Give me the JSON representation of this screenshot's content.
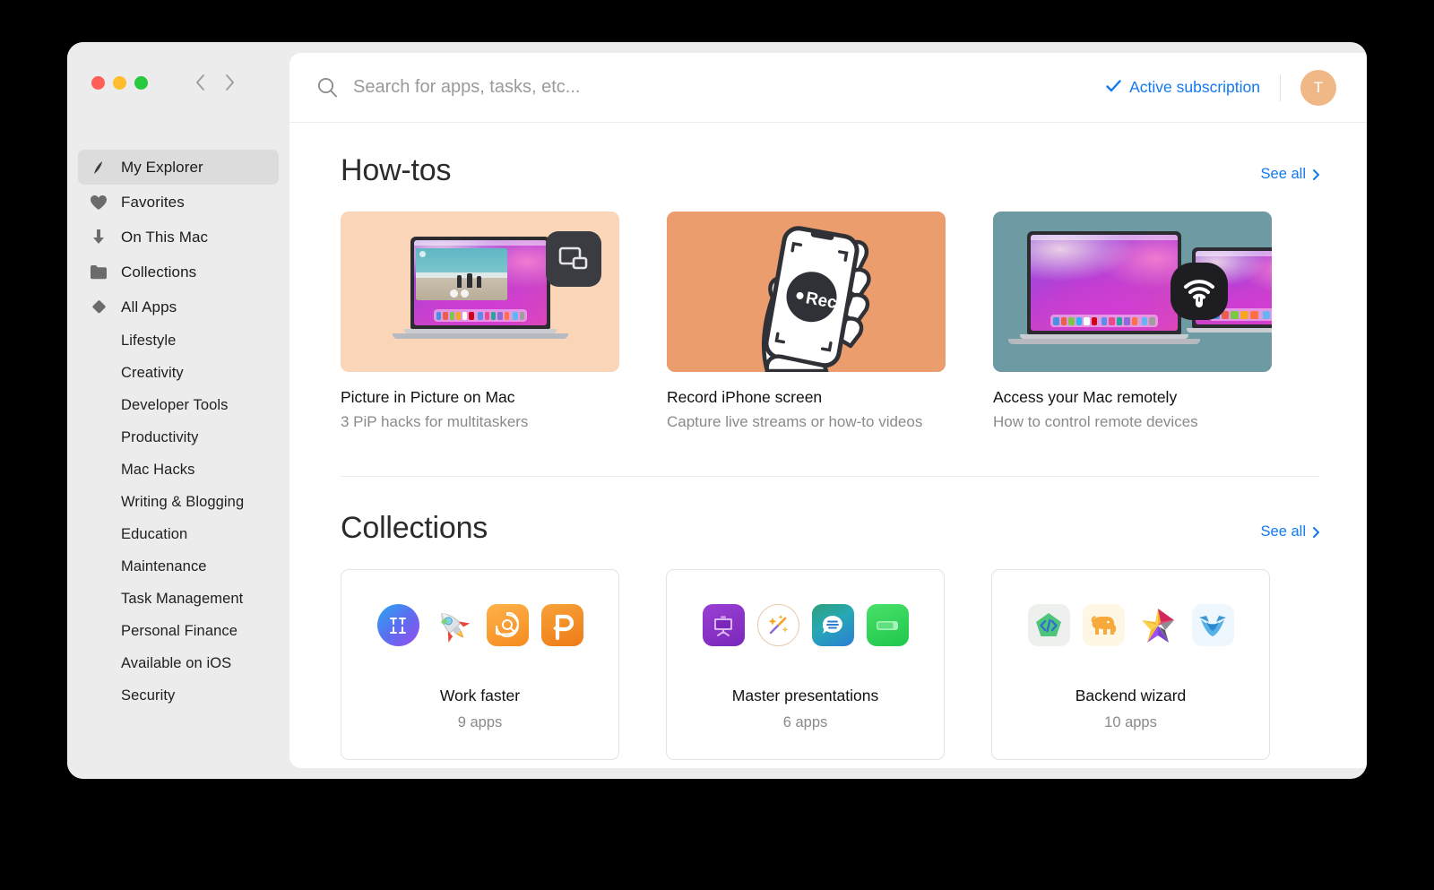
{
  "window": {
    "traffic_lights": [
      "close",
      "minimize",
      "zoom"
    ],
    "nav_back": "back-chevron",
    "nav_forward": "forward-chevron"
  },
  "sidebar": {
    "items": [
      {
        "label": "My Explorer",
        "icon": "explorer-icon",
        "selected": true
      },
      {
        "label": "Favorites",
        "icon": "heart-icon",
        "selected": false
      },
      {
        "label": "On This Mac",
        "icon": "download-arrow-icon",
        "selected": false
      },
      {
        "label": "Collections",
        "icon": "folder-icon",
        "selected": false
      },
      {
        "label": "All Apps",
        "icon": "diamond-icon",
        "selected": false
      }
    ],
    "categories": [
      {
        "label": "Lifestyle"
      },
      {
        "label": "Creativity"
      },
      {
        "label": "Developer Tools"
      },
      {
        "label": "Productivity"
      },
      {
        "label": "Mac Hacks"
      },
      {
        "label": "Writing & Blogging"
      },
      {
        "label": "Education"
      },
      {
        "label": "Maintenance"
      },
      {
        "label": "Task Management"
      },
      {
        "label": "Personal Finance"
      },
      {
        "label": "Available on iOS"
      },
      {
        "label": "Security"
      }
    ]
  },
  "topbar": {
    "search_placeholder": "Search for apps, tasks, etc...",
    "search_value": "",
    "subscription_label": "Active subscription",
    "subscription_color": "#1279f2",
    "avatar_initial": "T",
    "avatar_color": "#f0b787"
  },
  "howtos": {
    "title": "How-tos",
    "see_all": "See all",
    "cards": [
      {
        "title": "Picture in Picture on Mac",
        "subtitle": "3 PiP hacks for multitaskers",
        "bg": "#fad5b8",
        "art": "macbook-with-pip-video"
      },
      {
        "title": "Record iPhone screen",
        "subtitle": "Capture live streams or how-to videos",
        "bg": "#eb9d6e",
        "art": "hand-holding-phone-recording"
      },
      {
        "title": "Access your Mac remotely",
        "subtitle": "How to control remote devices",
        "bg": "#6e9aa3",
        "art": "two-macbooks-remote-access"
      }
    ]
  },
  "collections": {
    "title": "Collections",
    "see_all": "See all",
    "cards": [
      {
        "name": "Work faster",
        "count": "9 apps",
        "icons": [
          "bettertouchtool-icon",
          "rocket-icon",
          "search-app-icon",
          "popclip-icon"
        ]
      },
      {
        "name": "Master presentations",
        "count": "6 apps",
        "icons": [
          "presentation-icon",
          "magic-wand-icon",
          "speech-bubble-icon",
          "green-slider-icon"
        ]
      },
      {
        "name": "Backend wizard",
        "count": "10 apps",
        "icons": [
          "code-pentagon-icon",
          "elephant-icon",
          "star-icon",
          "blue-fox-icon"
        ]
      }
    ]
  }
}
